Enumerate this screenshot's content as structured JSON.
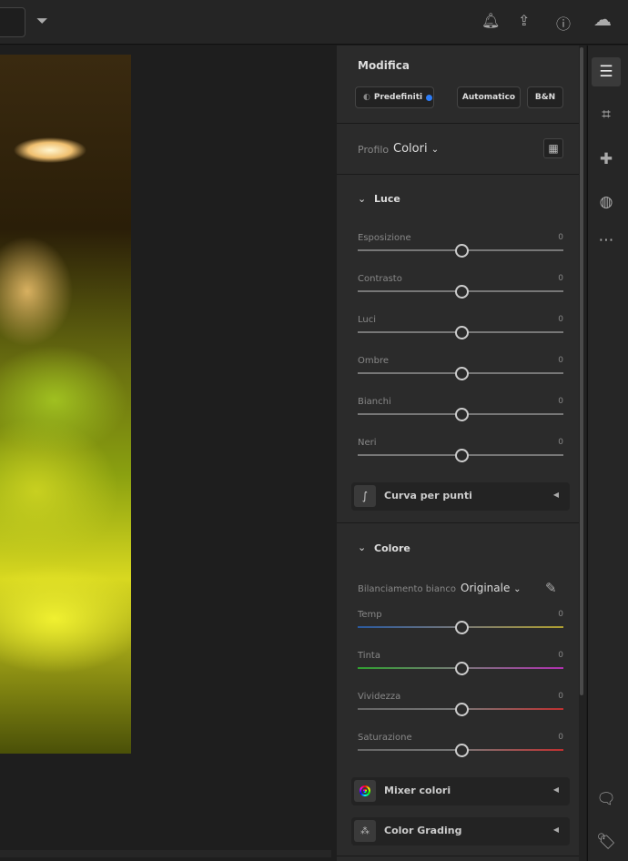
{
  "header": {
    "title": "Modifica",
    "presets": "Predefiniti",
    "auto": "Automatico",
    "bw": "B&N",
    "profile_label": "Profilo",
    "profile_value": "Colori"
  },
  "light": {
    "title": "Luce",
    "sliders": [
      {
        "label": "Esposizione",
        "value": "0"
      },
      {
        "label": "Contrasto",
        "value": "0"
      },
      {
        "label": "Luci",
        "value": "0"
      },
      {
        "label": "Ombre",
        "value": "0"
      },
      {
        "label": "Bianchi",
        "value": "0"
      },
      {
        "label": "Neri",
        "value": "0"
      }
    ],
    "curve": "Curva per punti"
  },
  "color": {
    "title": "Colore",
    "wb_label": "Bilanciamento bianco",
    "wb_value": "Originale",
    "sliders": [
      {
        "label": "Temp",
        "value": "0",
        "gradient": [
          "#2a5aa0",
          "#b0a030"
        ]
      },
      {
        "label": "Tinta",
        "value": "0",
        "gradient": [
          "#30a030",
          "#b030b0"
        ]
      },
      {
        "label": "Vividezza",
        "value": "0",
        "gradient": [
          "#666666",
          "#c03030"
        ]
      },
      {
        "label": "Saturazione",
        "value": "0",
        "gradient": [
          "#666666",
          "#c03030"
        ]
      }
    ],
    "mixer": "Mixer colori",
    "grading": "Color Grading"
  },
  "accent": "#2d7cf6"
}
